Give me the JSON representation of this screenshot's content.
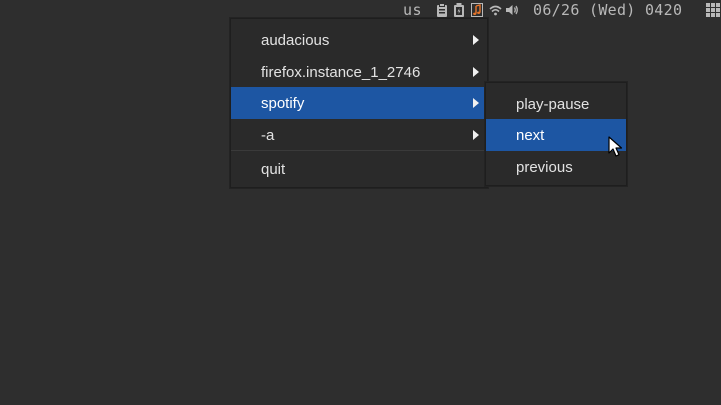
{
  "status_bar": {
    "keyboard_layout": "us",
    "tray_icons": [
      "clipboard-icon",
      "battery-icon",
      "music-note-icon",
      "wifi-icon",
      "volume-icon"
    ],
    "datetime": "06/26 (Wed) 0420",
    "launcher_icon": "grid-icon"
  },
  "menu": {
    "items": [
      {
        "label": "audacious",
        "has_submenu": true,
        "selected": false
      },
      {
        "label": "firefox.instance_1_2746",
        "has_submenu": true,
        "selected": false
      },
      {
        "label": "spotify",
        "has_submenu": true,
        "selected": true
      },
      {
        "label": "-a",
        "has_submenu": true,
        "selected": false
      },
      {
        "label": "quit",
        "has_submenu": false,
        "selected": false
      }
    ]
  },
  "submenu": {
    "items": [
      {
        "label": "play-pause",
        "selected": false
      },
      {
        "label": "next",
        "selected": true
      },
      {
        "label": "previous",
        "selected": false
      }
    ]
  },
  "colors": {
    "background": "#2e2e2e",
    "menu_background": "#2a2a2a",
    "selection": "#1d56a3",
    "text": "#e2e2e2",
    "music_icon_accent": "#e8762b"
  }
}
